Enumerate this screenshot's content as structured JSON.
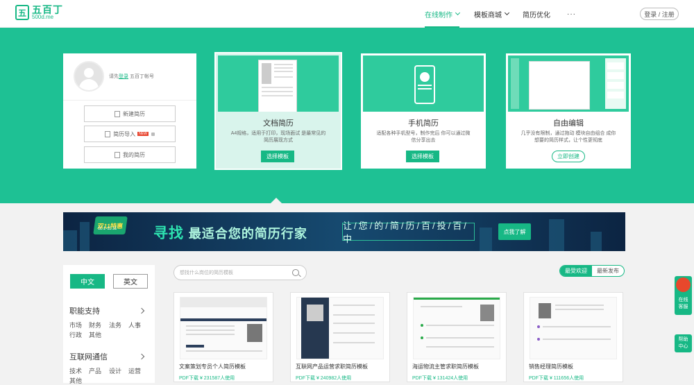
{
  "header": {
    "logo_mark": "五",
    "logo_title": "五百丁",
    "logo_sub": "500d.me",
    "nav": [
      "在线制作",
      "模板商城",
      "简历优化",
      "···"
    ],
    "login": "登录 / 注册"
  },
  "user": {
    "tip_prefix": "请先",
    "tip_link": "登录",
    "tip_suffix": "五百丁帐号",
    "buttons": [
      "新建简历",
      "简历导入",
      "我的简历"
    ],
    "new_badge": "NEW"
  },
  "cards": [
    {
      "title": "文档简历",
      "desc": "A4规格，适用于打印，现场面试 是最常见的简历展现方式",
      "btn": "选择模板"
    },
    {
      "title": "手机简历",
      "desc": "适配各种手机型号，制作完后 你可以通过微信分享出去",
      "btn": "选择模板"
    },
    {
      "title": "自由编辑",
      "desc": "几乎没有限制，通过拖动 模块自由组合 成你想要的简历样式，让个性更彻底",
      "btn": "立即创建"
    }
  ],
  "banner": {
    "tag": "双11特惠",
    "date": "11.1-11.11",
    "main_a": "寻找",
    "main_b": "最适合您的简历行家",
    "sub": "让/您/的/简/历/百/投/百/中",
    "btn": "点我了解"
  },
  "filter": {
    "lang": [
      "中文",
      "英文"
    ],
    "groups": [
      {
        "name": "职能支持",
        "items": [
          "市场",
          "财务",
          "法务",
          "人事",
          "行政",
          "其他"
        ]
      },
      {
        "name": "互联网通信",
        "items": [
          "技术",
          "产品",
          "设计",
          "运营",
          "其他"
        ]
      }
    ]
  },
  "search_placeholder": "想找什么岗位的简历模板",
  "sort": [
    "最受欢迎",
    "最新发布"
  ],
  "templates": [
    {
      "name": "文案策划专员个人简历模板",
      "meta": "PDF下载 ¥ 231587人使用"
    },
    {
      "name": "互联网产品运营求职简历模板",
      "meta": "PDF下载 ¥ 240982人使用"
    },
    {
      "name": "海运物流主管求职简历模板",
      "meta": "PDF下载 ¥ 131424人使用"
    },
    {
      "name": "销售经理简历模板",
      "meta": "PDF下载 ¥ 111656人使用"
    }
  ],
  "float": {
    "online": "在线客服",
    "help": "帮助中心"
  },
  "colors": {
    "brand": "#17b885",
    "band": "#1ec194"
  }
}
